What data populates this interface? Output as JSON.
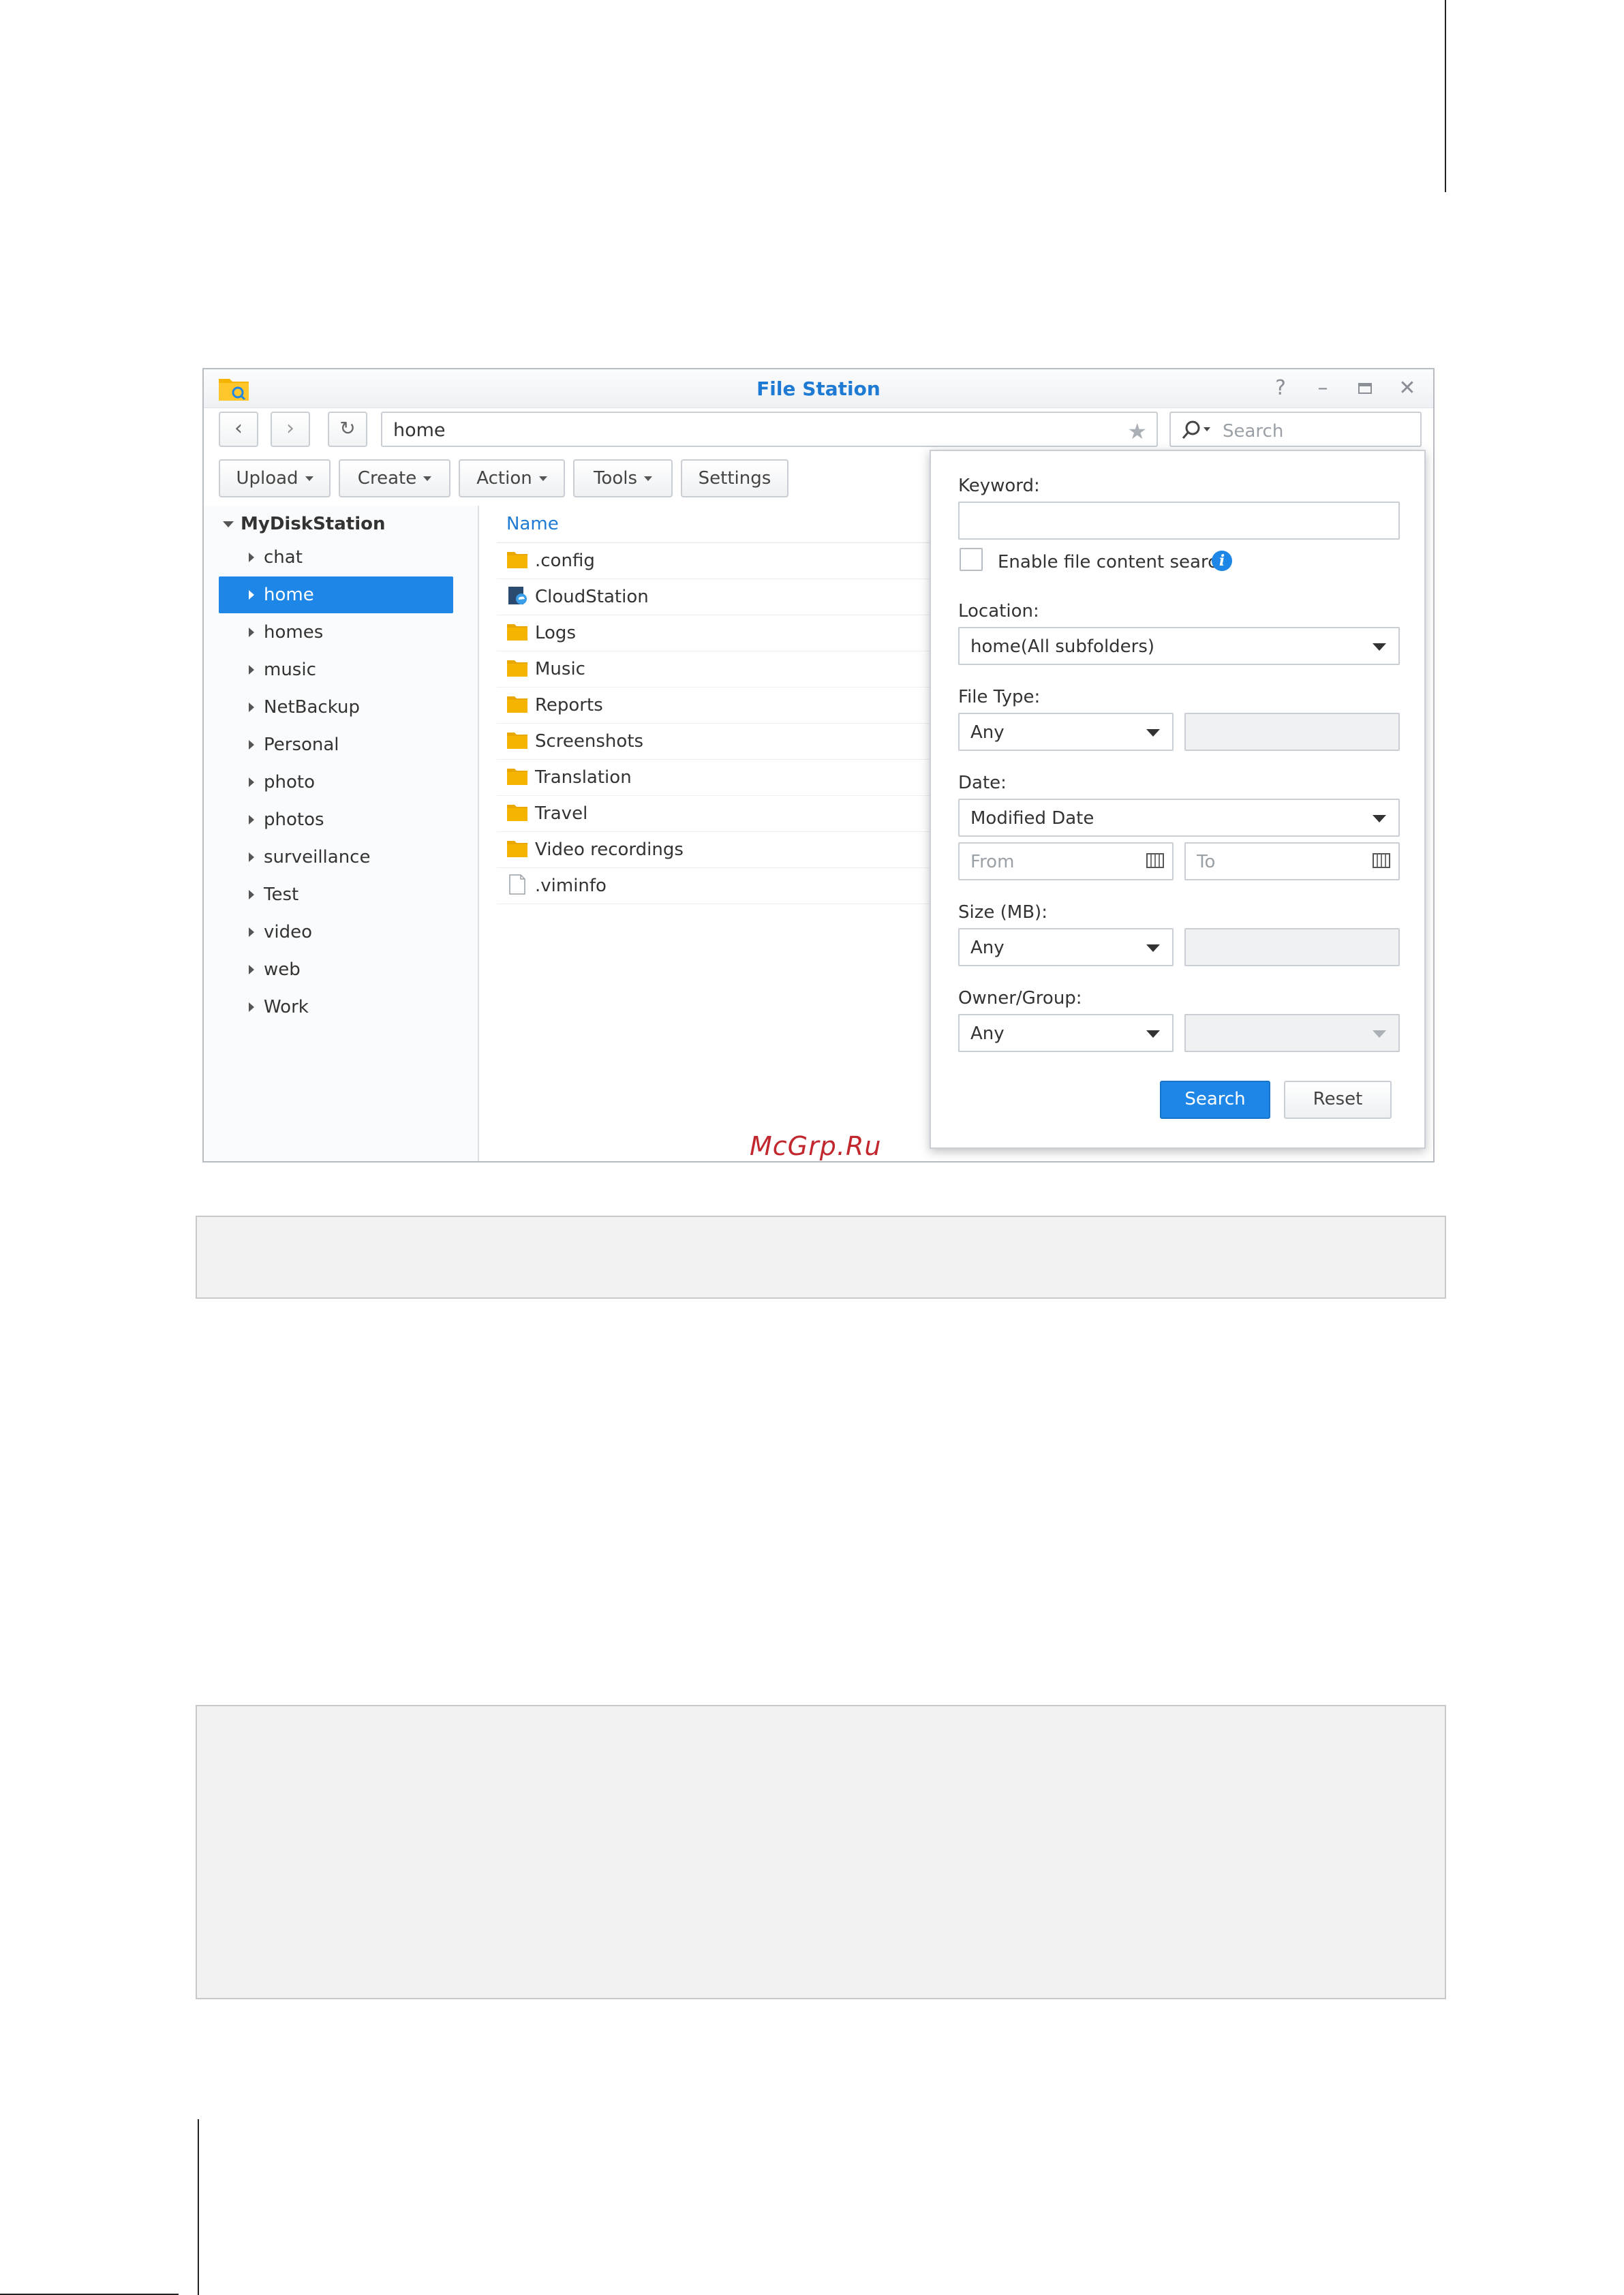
{
  "window": {
    "title": "File Station"
  },
  "navigation": {
    "path": "home",
    "search_placeholder": "Search"
  },
  "toolbar": {
    "upload_label": "Upload",
    "create_label": "Create",
    "action_label": "Action",
    "tools_label": "Tools",
    "settings_label": "Settings"
  },
  "sidebar": {
    "root_label": "MyDiskStation",
    "items": [
      {
        "label": "chat"
      },
      {
        "label": "home",
        "selected": true
      },
      {
        "label": "homes"
      },
      {
        "label": "music"
      },
      {
        "label": "NetBackup"
      },
      {
        "label": "Personal"
      },
      {
        "label": "photo"
      },
      {
        "label": "photos"
      },
      {
        "label": "surveillance"
      },
      {
        "label": "Test"
      },
      {
        "label": "video"
      },
      {
        "label": "web"
      },
      {
        "label": "Work"
      }
    ]
  },
  "filelist": {
    "column_name": "Name",
    "files": [
      {
        "name": ".config",
        "icon": "folder-icon"
      },
      {
        "name": "CloudStation",
        "icon": "cloudstation-folder-icon"
      },
      {
        "name": "Logs",
        "icon": "folder-icon"
      },
      {
        "name": "Music",
        "icon": "folder-icon"
      },
      {
        "name": "Reports",
        "icon": "folder-icon"
      },
      {
        "name": "Screenshots",
        "icon": "folder-icon"
      },
      {
        "name": "Translation",
        "icon": "folder-icon"
      },
      {
        "name": "Travel",
        "icon": "folder-icon"
      },
      {
        "name": "Video recordings",
        "icon": "folder-icon"
      },
      {
        "name": ".viminfo",
        "icon": "file-icon"
      }
    ]
  },
  "search_panel": {
    "keyword_label": "Keyword:",
    "keyword_value": "",
    "content_search_label": "Enable file content search",
    "location_label": "Location:",
    "location_value": "home(All subfolders)",
    "file_type_label": "File Type:",
    "file_type_value": "Any",
    "date_label": "Date:",
    "date_value": "Modified Date",
    "from_placeholder": "From",
    "to_placeholder": "To",
    "size_label": "Size (MB):",
    "size_value": "Any",
    "owner_label": "Owner/Group:",
    "owner_value": "Any",
    "search_button": "Search",
    "reset_button": "Reset"
  },
  "watermark": "McGrp.Ru",
  "colors": {
    "accent": "#1d86e6",
    "title": "#1f7ad4",
    "folder": "#f5b400",
    "watermark": "#c1272d"
  }
}
